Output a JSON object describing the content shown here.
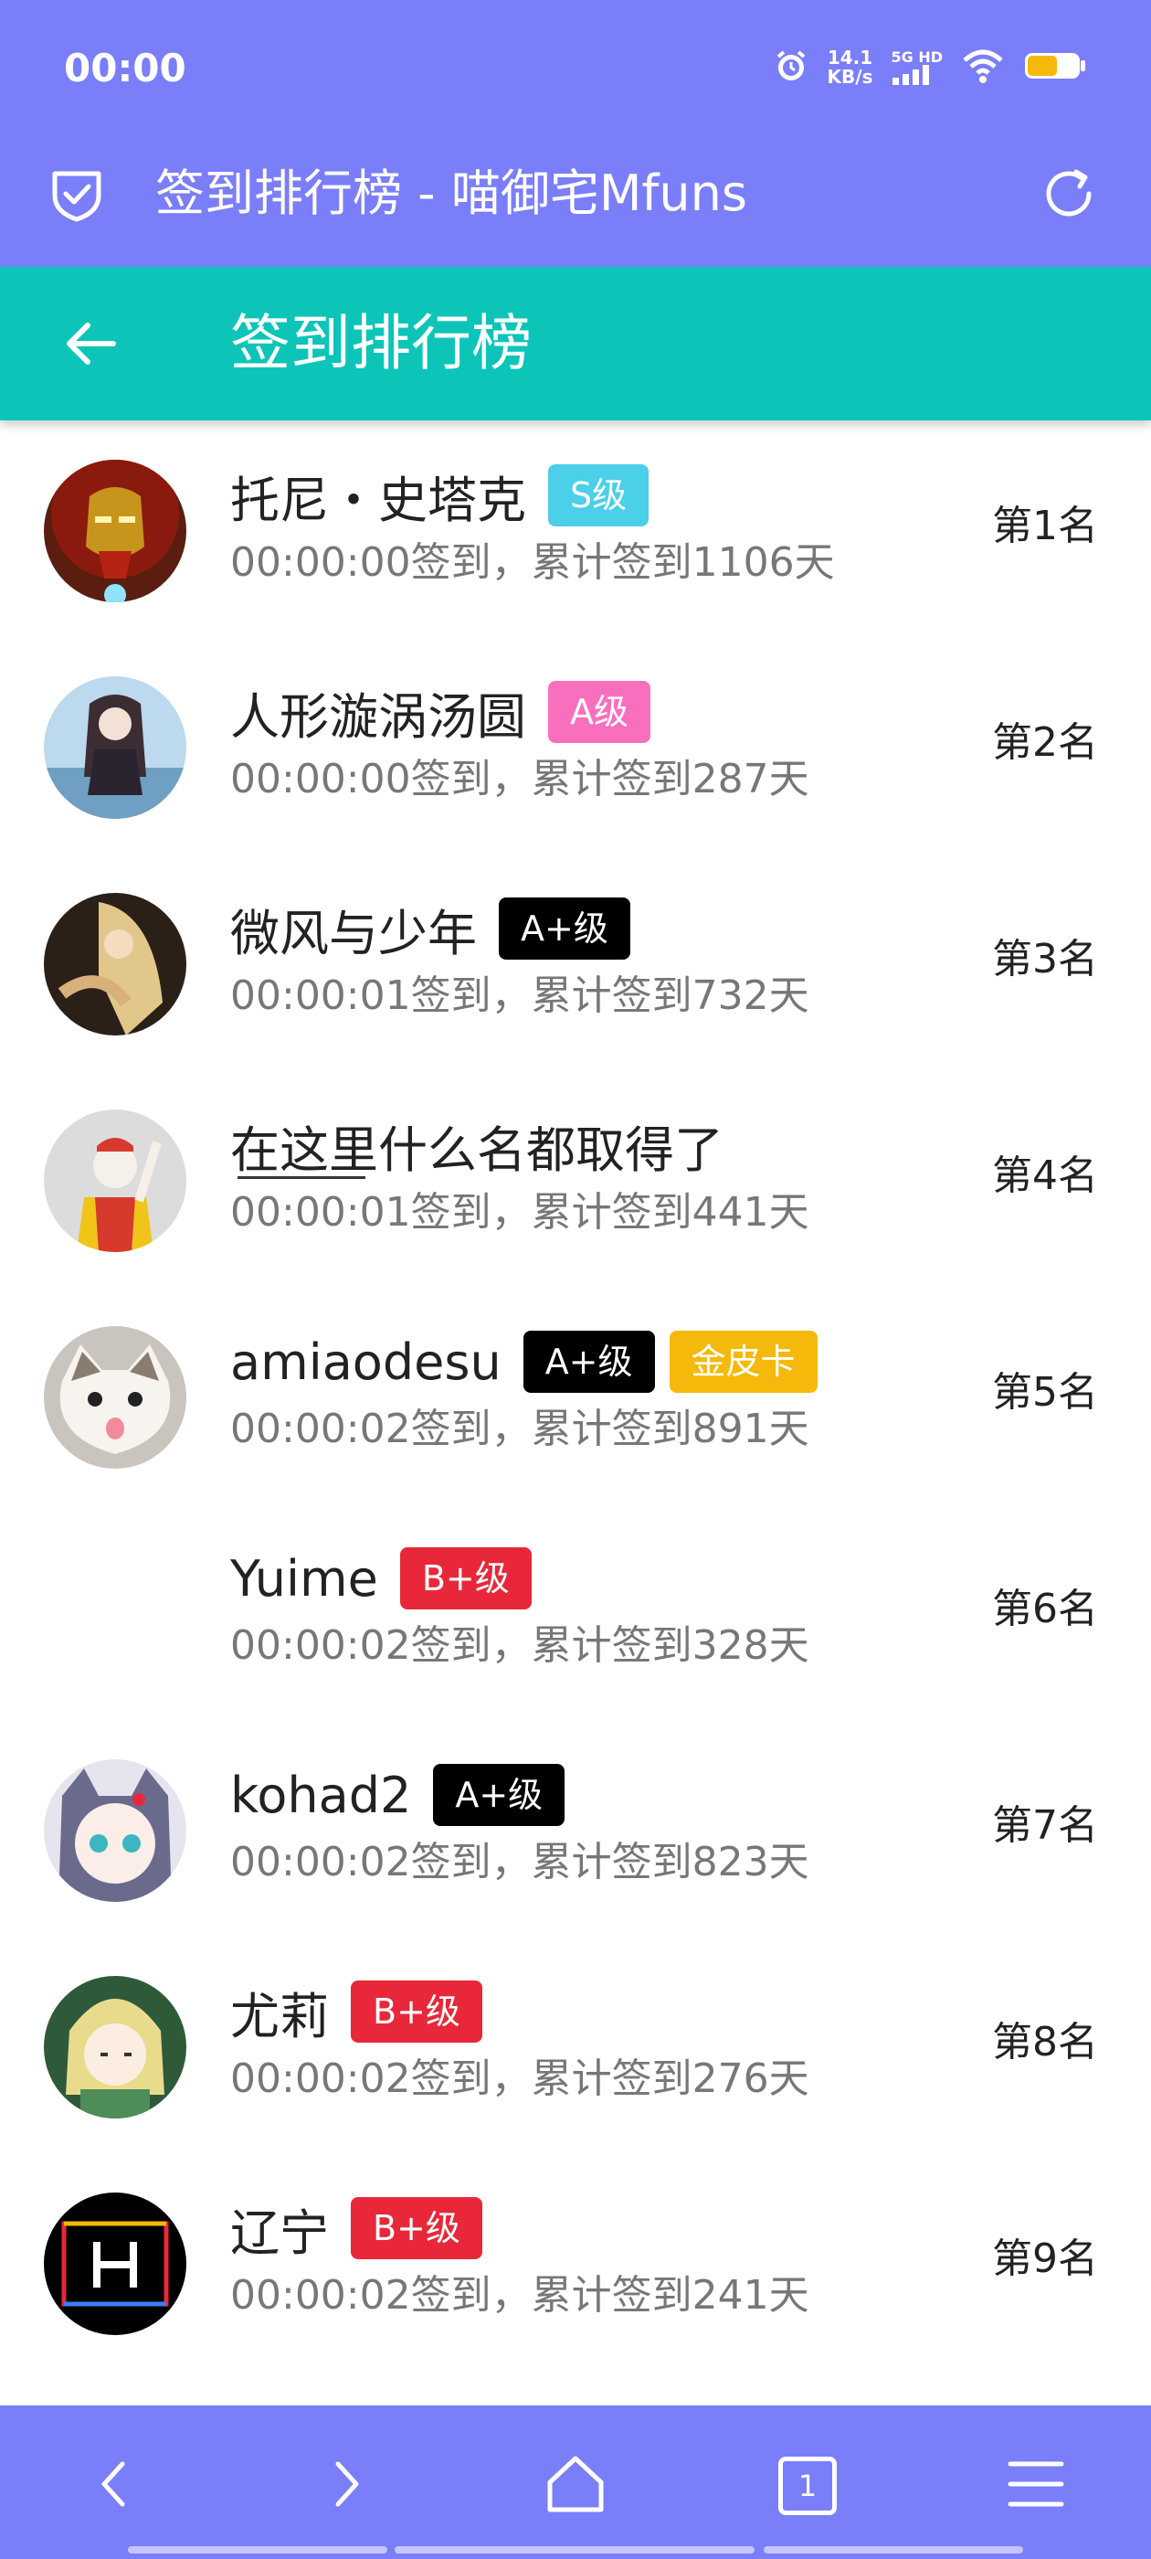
{
  "status_bar": {
    "time": "00:00",
    "net_speed_value": "14.1",
    "net_speed_unit": "KB/s",
    "network": "5G HD"
  },
  "browser_bar": {
    "title": "签到排行榜 - 喵御宅Mfuns"
  },
  "app_bar": {
    "title": "签到排行榜"
  },
  "colors": {
    "status_bg": "#7b7ef9",
    "app_bar_bg": "#0cc5b8",
    "badge_s": "#4ccfe8",
    "badge_a": "#f86fbe",
    "badge_aplus": "#000000",
    "badge_bplus": "#e8283a",
    "badge_gold": "#f4b90a"
  },
  "entries": [
    {
      "name": "托尼・史塔克",
      "badges": [
        {
          "label": "S级",
          "color": "#4ccfe8"
        }
      ],
      "subtitle": "00:00:00签到，累计签到1106天",
      "rank": "第1名",
      "avatar": "iron-man"
    },
    {
      "name": "人形漩涡汤圆",
      "badges": [
        {
          "label": "A级",
          "color": "#f86fbe"
        }
      ],
      "subtitle": "00:00:00签到，累计签到287天",
      "rank": "第2名",
      "avatar": "anime-girl-blue"
    },
    {
      "name": "微风与少年",
      "badges": [
        {
          "label": "A+级",
          "color": "#000000"
        }
      ],
      "subtitle": "00:00:01签到，累计签到732天",
      "rank": "第3名",
      "avatar": "anime-blonde"
    },
    {
      "name": "在这里什么名都取得了",
      "badges": [],
      "subtitle": "00:00:01签到，累计签到441天",
      "rank": "第4名",
      "avatar": "clown"
    },
    {
      "name": "amiaodesu",
      "badges": [
        {
          "label": "A+级",
          "color": "#000000"
        },
        {
          "label": "金皮卡",
          "color": "#f4b90a"
        }
      ],
      "subtitle": "00:00:02签到，累计签到891天",
      "rank": "第5名",
      "avatar": "cat"
    },
    {
      "name": "Yuime",
      "badges": [
        {
          "label": "B+级",
          "color": "#e8283a"
        }
      ],
      "subtitle": "00:00:02签到，累计签到328天",
      "rank": "第6名",
      "avatar": "blank"
    },
    {
      "name": "kohad2",
      "badges": [
        {
          "label": "A+级",
          "color": "#000000"
        }
      ],
      "subtitle": "00:00:02签到，累计签到823天",
      "rank": "第7名",
      "avatar": "anime-catgirl"
    },
    {
      "name": "尤莉",
      "badges": [
        {
          "label": "B+级",
          "color": "#e8283a"
        }
      ],
      "subtitle": "00:00:02签到，累计签到276天",
      "rank": "第8名",
      "avatar": "anime-green"
    },
    {
      "name": "辽宁",
      "badges": [
        {
          "label": "B+级",
          "color": "#e8283a"
        }
      ],
      "subtitle": "00:00:02签到，累计签到241天",
      "rank": "第9名",
      "avatar": "neon-h"
    }
  ],
  "nav": {
    "tab_count": "1"
  }
}
